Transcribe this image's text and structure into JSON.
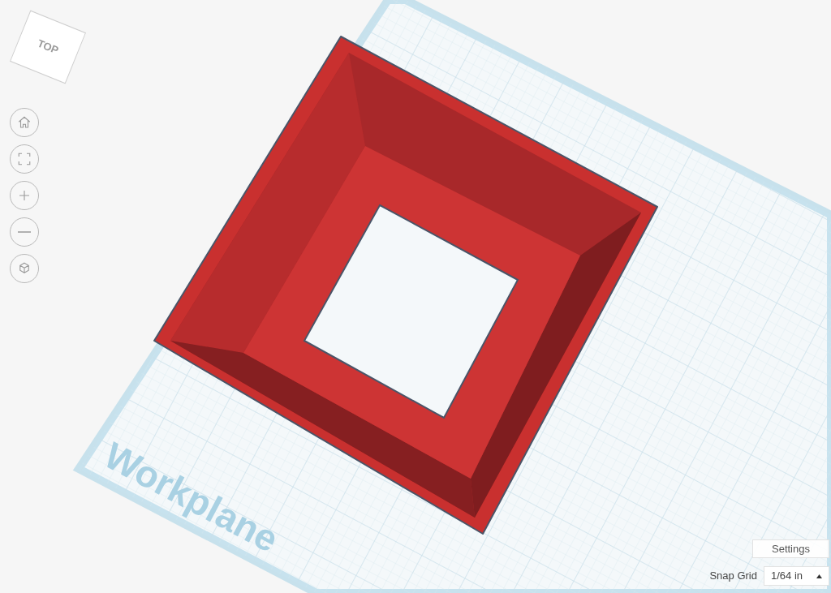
{
  "view_cube": {
    "face": "TOP"
  },
  "workplane": {
    "label": "Workplane"
  },
  "settings_button": {
    "label": "Settings"
  },
  "snap_grid": {
    "label": "Snap Grid",
    "value": "1/64 in"
  }
}
